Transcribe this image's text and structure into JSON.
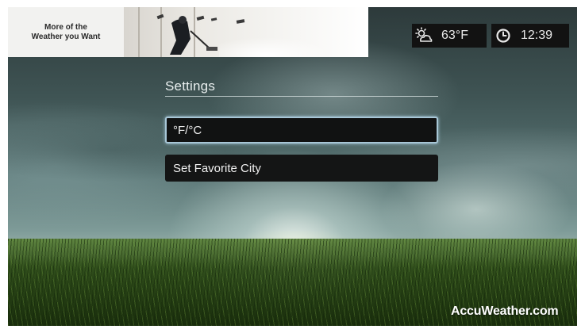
{
  "ad": {
    "text": "More of the\nWeather you Want"
  },
  "status": {
    "weather_icon": "partly-sunny-icon",
    "temperature": "63°F",
    "clock_icon": "clock-icon",
    "time": "12:39"
  },
  "settings": {
    "title": "Settings",
    "items": [
      {
        "label": "°F/°C",
        "selected": true
      },
      {
        "label": "Set Favorite City",
        "selected": false
      }
    ]
  },
  "brand": {
    "name": "AccuWeather.com"
  },
  "colors": {
    "menu_bg": "#141515",
    "selection_border": "#a7c6d6",
    "status_bg": "#121212"
  }
}
